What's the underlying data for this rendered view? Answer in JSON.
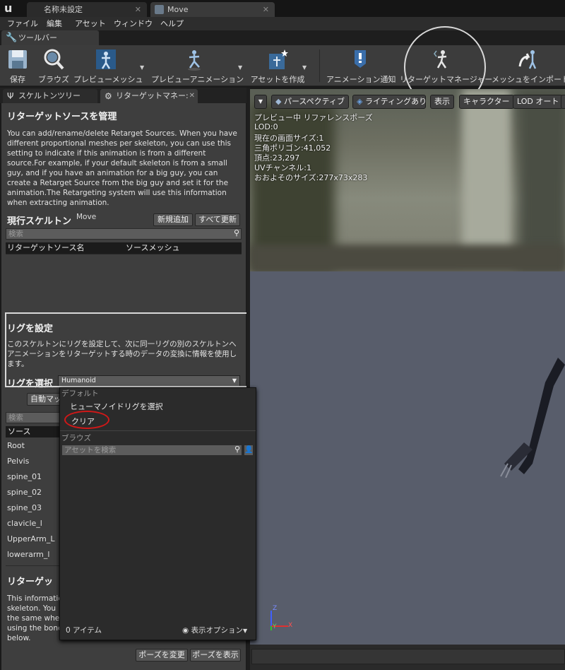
{
  "app": {
    "logo": "unreal-logo"
  },
  "tabs": [
    {
      "label": "名称未設定",
      "active": false
    },
    {
      "label": "Move",
      "active": true
    }
  ],
  "menu": [
    "ファイル",
    "編集",
    "アセット",
    "ウィンドウ",
    "ヘルプ"
  ],
  "toolbar_tab": "ツールバー",
  "toolbar": {
    "save": "保存",
    "browse": "ブラウズ",
    "preview_mesh": "プレビューメッシュ",
    "preview_anim": "プレビューアニメーション",
    "create_asset": "アセットを作成",
    "anim_notify": "アニメーション通知",
    "retarget_manager": "リターゲットマネージャー",
    "import_mesh": "メッシュをインポート"
  },
  "panel_tabs": {
    "skeleton_tree": "スケルトンツリー",
    "retarget_manager": "リターゲットマネー:"
  },
  "retarget_source": {
    "title": "リターゲットソースを管理",
    "description": "You can add/rename/delete Retarget Sources. When you have different proportional meshes per skeleton, you can use this setting to indicate if this animation is from a different source.For example, if your default skeleton is from a small guy, and if you have an animation for a big guy, you can create a Retarget Source from the big guy and set it for the animation.The Retargeting system will use this information when extracting animation.",
    "current_skeleton_label": "現行スケルトン",
    "current_skeleton_value": "Move",
    "add_new": "新規追加",
    "update_all": "すべて更新",
    "search_placeholder": "検索",
    "col_name": "リターゲットソース名",
    "col_mesh": "ソースメッシュ"
  },
  "rig": {
    "title": "リグを設定",
    "description": "このスケルトンにリグを設定して、次に同一リグの別のスケルトンへアニメーションをリターゲットする時のデータの変換に情報を使用します。",
    "select_label": "リグを選択",
    "selected": "Humanoid",
    "auto_map": "自動マッ",
    "search_placeholder": "検索",
    "col_source": "ソース",
    "bones": [
      "Root",
      "Pelvis",
      "spine_01",
      "spine_02",
      "spine_03",
      "clavicle_l",
      "UpperArm_L",
      "lowerarm_l"
    ]
  },
  "retarget_pose": {
    "title": "リターゲッ",
    "description_lines": [
      "This informatio",
      "skeleton. You ",
      "the same wher",
      "using the bone",
      "below."
    ],
    "modify_pose": "ポーズを変更",
    "view_pose": "ポーズを表示"
  },
  "dropdown": {
    "section_default": "デフォルト",
    "select_humanoid": "ヒューマノイドリグを選択",
    "clear": "クリア",
    "section_browse": "ブラウズ",
    "search_placeholder": "アセットを検索",
    "item_count": "0 アイテム",
    "view_options": "表示オプション"
  },
  "viewport": {
    "buttons": [
      "パースペクティブ",
      "ライティングあり",
      "表示",
      "キャラクター",
      "LOD オート"
    ],
    "stats": [
      "プレビュー中 リファレンスポーズ",
      "LOD:0",
      "現在の画面サイズ:1",
      "三角ポリゴン:41,052",
      "頂点:23,297",
      "UVチャンネル:1",
      "おおよそのサイズ:277x73x283"
    ],
    "axes": {
      "x": "X",
      "y": "Y",
      "z": "Z"
    }
  },
  "colors": {
    "accent_circle": "#d9d9d9",
    "red_circle": "#d01818",
    "panel": "#3e3e3e",
    "viewport_floor": "#585d6b"
  }
}
